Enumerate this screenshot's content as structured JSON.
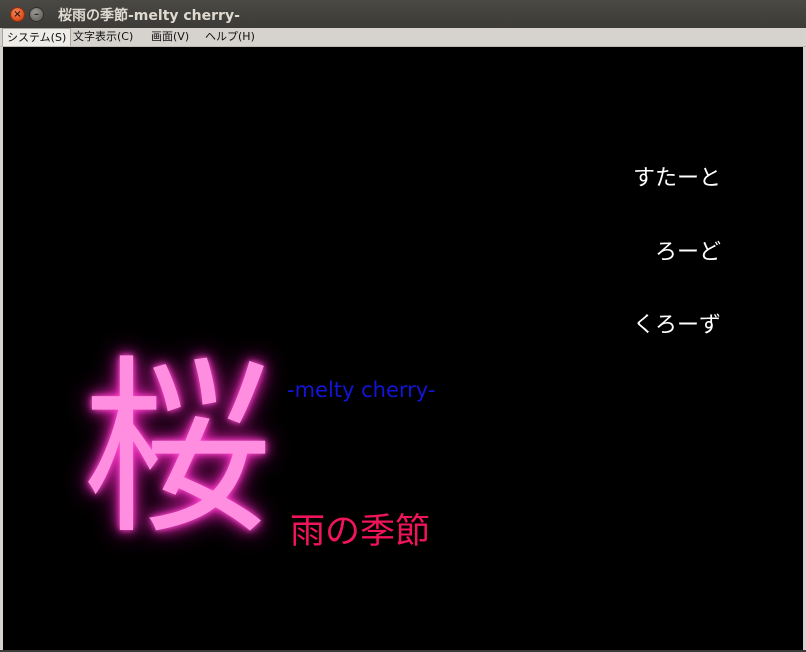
{
  "window": {
    "title": "桜雨の季節-melty cherry-",
    "close_glyph": "×",
    "minimize_glyph": "–"
  },
  "menubar": {
    "items": [
      {
        "label": "システム(S)"
      },
      {
        "label": "文字表示(C)"
      },
      {
        "label": "画面(V)"
      },
      {
        "label": "ヘルプ(H)"
      }
    ]
  },
  "game": {
    "start_label": "すたーと",
    "load_label": "ろーど",
    "close_label": "くろーず",
    "logo_kanji": "桜",
    "logo_subtitle": "-melty cherry-",
    "logo_tagline": "雨の季節"
  },
  "colors": {
    "background": "#000000",
    "menu_text": "#ffffff",
    "logo_pink": "#ff8ee0",
    "subtitle_blue": "#1414d8",
    "tagline_red": "#f0145a"
  }
}
